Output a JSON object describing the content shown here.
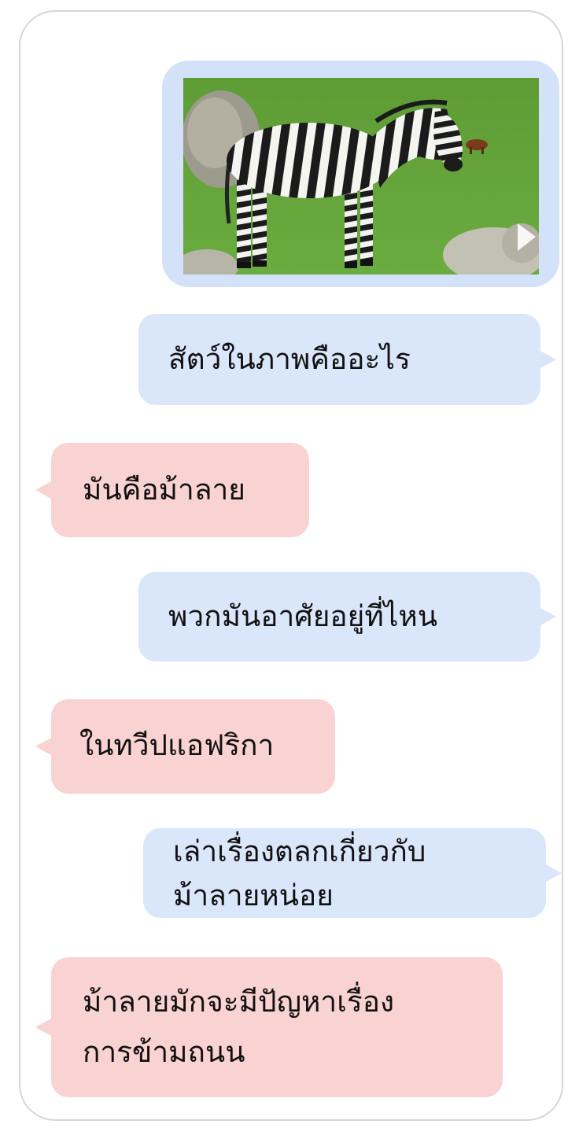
{
  "image": {
    "alt": "zebra standing on grass",
    "icon": "play-icon"
  },
  "messages": [
    {
      "role": "user",
      "text": "สัตว์ในภาพคืออะไร"
    },
    {
      "role": "bot",
      "text": "มันคือม้าลาย"
    },
    {
      "role": "user",
      "text": "พวกมันอาศัยอยู่ที่ไหน"
    },
    {
      "role": "bot",
      "text": "ในทวีปแอฟริกา"
    },
    {
      "role": "user",
      "lines": [
        "เล่าเรื่องตลกเกี่ยวกับ",
        "ม้าลายหน่อย"
      ]
    },
    {
      "role": "bot",
      "lines": [
        "ม้าลายมักจะมีปัญหาเรื่อง",
        "การข้ามถนน"
      ]
    }
  ],
  "colors": {
    "user_bubble": "#dae6fa",
    "bot_bubble": "#f9d2d2",
    "frame_border": "#d6d6d6"
  }
}
